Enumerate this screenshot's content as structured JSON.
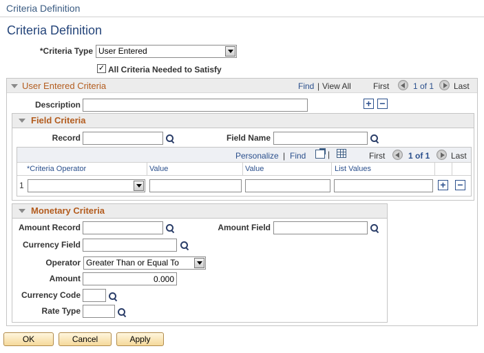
{
  "header": {
    "breadcrumb_title": "Criteria Definition",
    "page_title": "Criteria Definition"
  },
  "criteria_type": {
    "label": "*Criteria Type",
    "value": "User Entered"
  },
  "all_criteria": {
    "label": "All Criteria Needed to Satisfy",
    "checked": true,
    "check_glyph": "✓"
  },
  "user_entered_criteria": {
    "title": "User Entered Criteria",
    "find": "Find",
    "separator": "|",
    "view_all": "View All",
    "first": "First",
    "page_info": "1 of 1",
    "last": "Last",
    "description_label": "Description",
    "description_value": "",
    "add_symbol": "+",
    "remove_symbol": "−"
  },
  "field_criteria": {
    "title": "Field Criteria",
    "record_label": "Record",
    "record_value": "",
    "field_name_label": "Field Name",
    "field_name_value": "",
    "grid": {
      "personalize": "Personalize",
      "separator": "|",
      "find": "Find",
      "first": "First",
      "page_info": "1 of 1",
      "last": "Last",
      "columns": [
        "*Criteria Operator",
        "Value",
        "Value",
        "List Values"
      ],
      "rows": [
        {
          "num": "1",
          "operator": "",
          "value1": "",
          "value2": "",
          "list_values": ""
        }
      ],
      "add_symbol": "+",
      "remove_symbol": "−"
    }
  },
  "monetary_criteria": {
    "title": "Monetary Criteria",
    "amount_record_label": "Amount Record",
    "amount_record_value": "",
    "amount_field_label": "Amount Field",
    "amount_field_value": "",
    "currency_field_label": "Currency Field",
    "currency_field_value": "",
    "operator_label": "Operator",
    "operator_value": "Greater Than or Equal To",
    "amount_label": "Amount",
    "amount_value": "0.000",
    "currency_code_label": "Currency Code",
    "currency_code_value": "",
    "rate_type_label": "Rate Type",
    "rate_type_value": ""
  },
  "buttons": {
    "ok": "OK",
    "cancel": "Cancel",
    "apply": "Apply"
  },
  "icons": {
    "lookup": "magnifier-icon",
    "collapse": "triangle-down-icon",
    "prev": "arrow-left-circle-icon",
    "next": "arrow-right-circle-icon",
    "export": "new-window-icon",
    "download": "spreadsheet-icon"
  },
  "colors": {
    "title": "#25457a",
    "section": "#b35c1e",
    "link": "#2a4f8c",
    "button": "#f5d99a"
  }
}
